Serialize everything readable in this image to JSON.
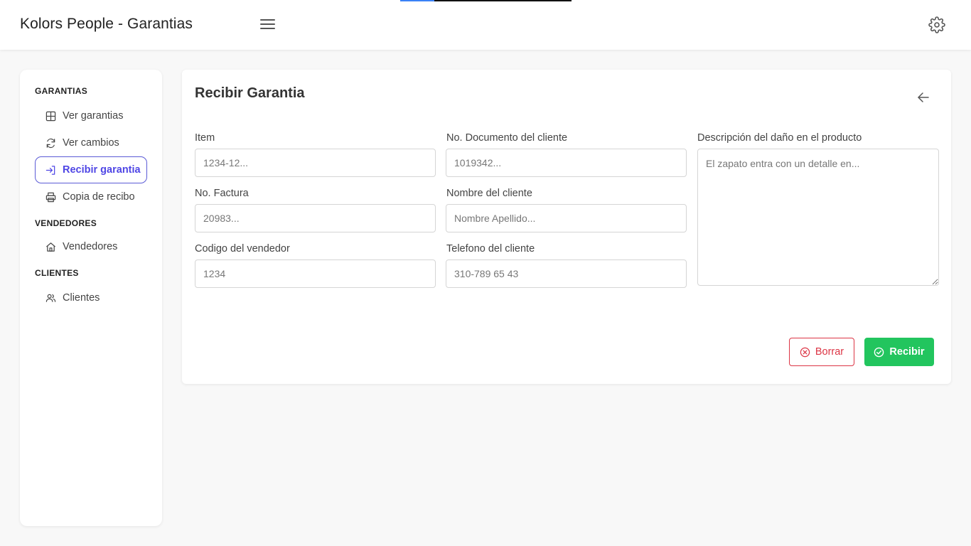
{
  "header": {
    "title": "Kolors People - Garantias",
    "menu_icon": "hamburger-menu-icon",
    "settings_icon": "gear-icon",
    "progress": 0.2
  },
  "sidebar": {
    "sections": [
      {
        "title": "GARANTIAS",
        "items": [
          {
            "label": "Ver garantias",
            "icon": "table-icon"
          },
          {
            "label": "Ver cambios",
            "icon": "refresh-icon"
          },
          {
            "label": "Recibir garantia",
            "icon": "login-arrow-icon",
            "active": true
          },
          {
            "label": "Copia de recibo",
            "icon": "printer-icon"
          }
        ]
      },
      {
        "title": "VENDEDORES",
        "items": [
          {
            "label": "Vendedores",
            "icon": "home-icon"
          }
        ]
      },
      {
        "title": "CLIENTES",
        "items": [
          {
            "label": "Clientes",
            "icon": "users-icon"
          }
        ]
      }
    ]
  },
  "form": {
    "title": "Recibir Garantia",
    "fields": {
      "item": {
        "label": "Item",
        "placeholder": "1234-12...",
        "value": ""
      },
      "factura": {
        "label": "No. Factura",
        "placeholder": "20983...",
        "value": ""
      },
      "vendedor": {
        "label": "Codigo del vendedor",
        "placeholder": "1234",
        "value": ""
      },
      "documento": {
        "label": "No. Documento del cliente",
        "placeholder": "1019342...",
        "value": ""
      },
      "nombre": {
        "label": "Nombre del cliente",
        "placeholder": "Nombre Apellido...",
        "value": ""
      },
      "telefono": {
        "label": "Telefono del cliente",
        "placeholder": "310-789 65 43",
        "value": ""
      },
      "descripcion": {
        "label": "Descripción del daño en el producto",
        "placeholder": "El zapato entra con un detalle en...",
        "value": ""
      }
    },
    "buttons": {
      "borrar": "Borrar",
      "recibir": "Recibir"
    }
  },
  "colors": {
    "accent": "#4f46e5",
    "danger": "#dc3545",
    "success": "#22c55e"
  }
}
